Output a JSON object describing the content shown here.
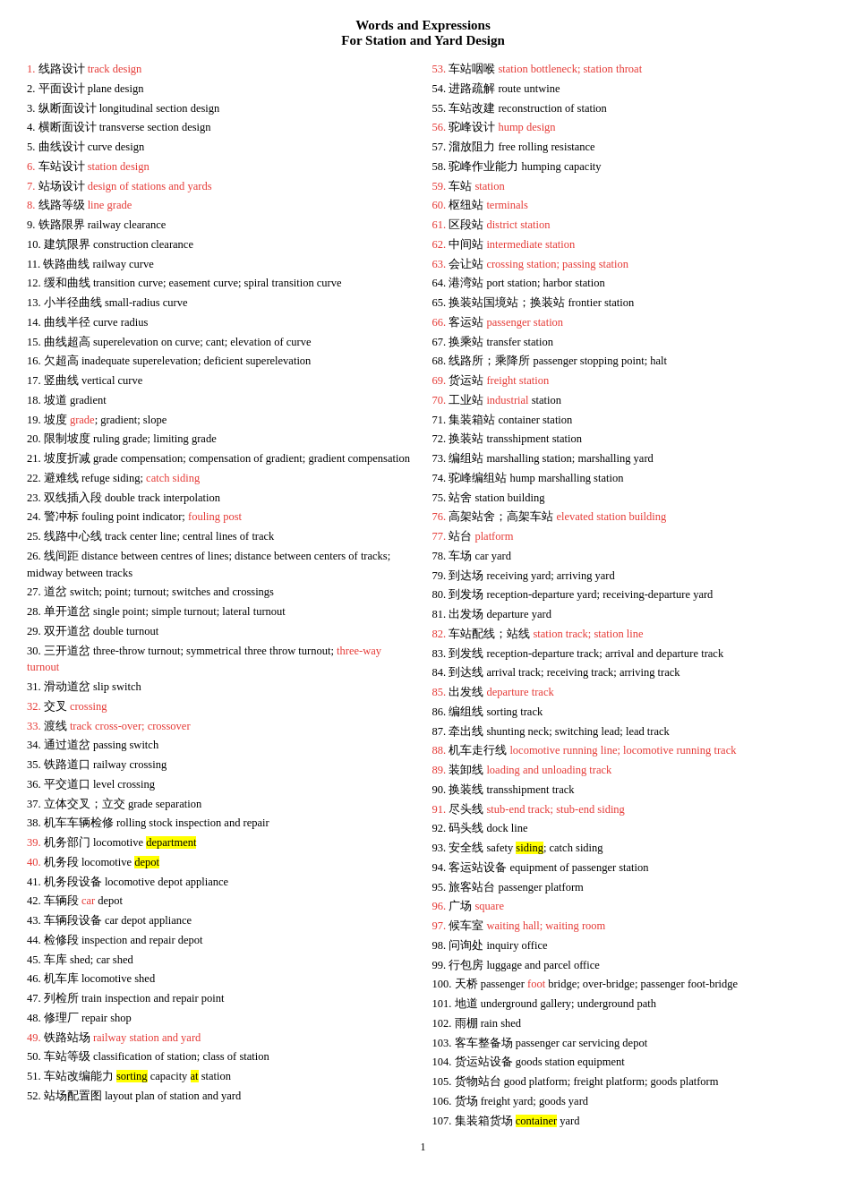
{
  "header": {
    "line1": "Words and Expressions",
    "line2": "For Station and Yard Design"
  },
  "left_items": [
    {
      "num": "1.",
      "num_color": "red",
      "content": "<span class='zh'>线路设计</span> <span class='en-red'>track design</span>"
    },
    {
      "num": "2.",
      "content": "<span class='zh'>平面设计</span> <span class='en'>plane design</span>"
    },
    {
      "num": "3.",
      "content": "<span class='zh'>纵断面设计</span> <span class='en'>longitudinal section design</span>"
    },
    {
      "num": "4.",
      "content": "<span class='zh'>横断面设计</span> <span class='en'>transverse section design</span>"
    },
    {
      "num": "5.",
      "content": "<span class='zh'>曲线设计</span> <span class='en'>curve design</span>"
    },
    {
      "num": "6.",
      "num_color": "red",
      "content": "<span class='zh'>车站设计</span> <span class='en-red'>station design</span>"
    },
    {
      "num": "7.",
      "num_color": "red",
      "content": "<span class='zh'>站场设计</span> <span class='en-red'>design of stations and yards</span>"
    },
    {
      "num": "8.",
      "num_color": "red",
      "content": "<span class='zh'>线路等级</span> <span class='en-red'>line grade</span>"
    },
    {
      "num": "9.",
      "content": "<span class='zh'>铁路限界</span> <span class='en'>railway clearance</span>"
    },
    {
      "num": "10.",
      "content": "<span class='zh'>建筑限界</span> <span class='en'>construction clearance</span>"
    },
    {
      "num": "11.",
      "content": "<span class='zh'>铁路曲线</span> <span class='en'>railway curve</span>"
    },
    {
      "num": "12.",
      "content": "<span class='zh'>缓和曲线</span> <span class='en'>transition curve; easement curve; spiral transition curve</span>"
    },
    {
      "num": "13.",
      "content": "<span class='zh'>小半径曲线</span> <span class='en'>small-radius curve</span>"
    },
    {
      "num": "14.",
      "content": "<span class='zh'>曲线半径</span> <span class='en'>curve radius</span>"
    },
    {
      "num": "15.",
      "content": "<span class='zh'>曲线超高</span> <span class='en'>superelevation on curve; cant; elevation of curve</span>"
    },
    {
      "num": "16.",
      "content": "<span class='zh'>欠超高</span> <span class='en'>inadequate superelevation; deficient superelevation</span>"
    },
    {
      "num": "17.",
      "content": "<span class='zh'>竖曲线</span> <span class='en'>vertical curve</span>"
    },
    {
      "num": "18.",
      "content": "<span class='zh'>坡道</span> <span class='en'>gradient</span>"
    },
    {
      "num": "19.",
      "content": "<span class='zh'>坡度</span> <span class='en-red'>grade</span><span class='en'>; gradient; slope</span>"
    },
    {
      "num": "20.",
      "content": "<span class='zh'>限制坡度</span> <span class='en'>ruling grade; limiting grade</span>"
    },
    {
      "num": "21.",
      "content": "<span class='zh'>坡度折减</span> <span class='en'>grade compensation; compensation of gradient; gradient compensation</span>"
    },
    {
      "num": "22.",
      "content": "<span class='zh'>避难线</span> <span class='en'>refuge siding; </span><span class='en-red'>catch siding</span>"
    },
    {
      "num": "23.",
      "content": "<span class='zh'>双线插入段</span> <span class='en'>double track interpolation</span>"
    },
    {
      "num": "24.",
      "content": "<span class='zh'>警冲标</span> <span class='en'>fouling point indicator; </span><span class='en-red'>fouling post</span>"
    },
    {
      "num": "25.",
      "content": "<span class='zh'>线路中心线</span> <span class='en'>track center line; central lines of track</span>"
    },
    {
      "num": "26.",
      "content": "<span class='zh'>线间距</span> <span class='en'>distance between centres of lines; distance between centers of tracks; midway between tracks</span>"
    },
    {
      "num": "27.",
      "content": "<span class='zh'>道岔</span> <span class='en'>switch; point; turnout; switches and crossings</span>"
    },
    {
      "num": "28.",
      "content": "<span class='zh'>单开道岔</span> <span class='en'>single point; simple turnout; lateral turnout</span>"
    },
    {
      "num": "29.",
      "content": "<span class='zh'>双开道岔</span> <span class='en'>double turnout</span>"
    },
    {
      "num": "30.",
      "content": "<span class='zh'>三开道岔</span> <span class='en'>three-throw turnout; symmetrical three throw turnout; </span><span class='en-red'>three-way turnout</span>"
    },
    {
      "num": "31.",
      "content": "<span class='zh'>滑动道岔</span> <span class='en'>slip switch</span>"
    },
    {
      "num": "32.",
      "num_color": "red",
      "content": "<span class='zh'>交叉</span> <span class='en-red'>crossing</span>"
    },
    {
      "num": "33.",
      "num_color": "red",
      "content": "<span class='zh'>渡线</span> <span class='en-red'>track cross-over; crossover</span>"
    },
    {
      "num": "34.",
      "content": "<span class='zh'>通过道岔</span> <span class='en'>passing switch</span>"
    },
    {
      "num": "35.",
      "content": "<span class='zh'>铁路道口</span> <span class='en'>railway crossing</span>"
    },
    {
      "num": "36.",
      "content": "<span class='zh'>平交道口</span> <span class='en'>level crossing</span>"
    },
    {
      "num": "37.",
      "content": "<span class='zh'>立体交叉；立交</span> <span class='en'>grade separation</span>"
    },
    {
      "num": "38.",
      "content": "<span class='zh'>机车车辆检修</span> <span class='en'>rolling stock inspection and repair</span>"
    },
    {
      "num": "39.",
      "num_color": "red",
      "content": "<span class='zh'>机务部门</span> <span class='en'>locomotive </span><span class='highlight-yellow'>department</span>"
    },
    {
      "num": "40.",
      "num_color": "red",
      "content": "<span class='zh'>机务段</span> <span class='en'>locomotive </span><span class='highlight-yellow'>depot</span>"
    },
    {
      "num": "41.",
      "content": "<span class='zh'>机务段设备</span> <span class='en'>locomotive depot appliance</span>"
    },
    {
      "num": "42.",
      "content": "<span class='zh'>车辆段</span> <span class='en-red'>car</span><span class='en'> depot</span>"
    },
    {
      "num": "43.",
      "content": "<span class='zh'>车辆段设备</span> <span class='en'>car depot appliance</span>"
    },
    {
      "num": "44.",
      "content": "<span class='zh'>检修段</span> <span class='en'>inspection and repair depot</span>"
    },
    {
      "num": "45.",
      "content": "<span class='zh'>车库</span> <span class='en'>shed; car shed</span>"
    },
    {
      "num": "46.",
      "content": "<span class='zh'>机车库</span> <span class='en'>locomotive shed</span>"
    },
    {
      "num": "47.",
      "content": "<span class='zh'>列检所</span> <span class='en'>train inspection and repair point</span>"
    },
    {
      "num": "48.",
      "content": "<span class='zh'>修理厂</span> <span class='en'>repair shop</span>"
    },
    {
      "num": "49.",
      "num_color": "red",
      "content": "<span class='zh'>铁路站场</span> <span class='en-red'>railway station and yard</span>"
    },
    {
      "num": "50.",
      "content": "<span class='zh'>车站等级</span> <span class='en'>classification of station; class of station</span>"
    },
    {
      "num": "51.",
      "content": "<span class='zh'>车站改编能力</span> <span class='en'></span><span class='highlight-yellow'>sorting</span><span class='en'> capacity </span><span class='highlight-yellow'>at</span><span class='en'> station</span>"
    },
    {
      "num": "52.",
      "content": "<span class='zh'>站场配置图</span> <span class='en'>layout plan of station and yard</span>"
    }
  ],
  "right_items": [
    {
      "num": "53.",
      "num_color": "red",
      "content": "<span class='zh'>车站咽喉</span> <span class='en-red'>station bottleneck; station throat</span>"
    },
    {
      "num": "54.",
      "content": "<span class='zh'>进路疏解</span> <span class='en'>route untwine</span>"
    },
    {
      "num": "55.",
      "content": "<span class='zh'>车站改建</span> <span class='en'>reconstruction of station</span>"
    },
    {
      "num": "56.",
      "num_color": "red",
      "content": "<span class='zh'>驼峰设计</span> <span class='en-red'>hump design</span>"
    },
    {
      "num": "57.",
      "content": "<span class='zh'>溜放阻力</span> <span class='en'>free rolling resistance</span>"
    },
    {
      "num": "58.",
      "content": "<span class='zh'>驼峰作业能力</span> <span class='en'>humping capacity</span>"
    },
    {
      "num": "59.",
      "num_color": "red",
      "content": "<span class='zh'>车站</span> <span class='en-red'>station</span>"
    },
    {
      "num": "60.",
      "num_color": "red",
      "content": "<span class='zh'>枢纽站</span> <span class='en-red'>terminals</span>"
    },
    {
      "num": "61.",
      "num_color": "red",
      "content": "<span class='zh'>区段站</span> <span class='en-red'>district station</span>"
    },
    {
      "num": "62.",
      "num_color": "red",
      "content": "<span class='zh'>中间站</span> <span class='en-red'>intermediate station</span>"
    },
    {
      "num": "63.",
      "num_color": "red",
      "content": "<span class='zh'>会让站</span> <span class='en-red'>crossing station; passing station</span>"
    },
    {
      "num": "64.",
      "content": "<span class='zh'>港湾站</span> <span class='en'>port station; harbor station</span>"
    },
    {
      "num": "65.",
      "content": "<span class='zh'>换装站国境站；换装站</span> <span class='en'>frontier station</span>"
    },
    {
      "num": "66.",
      "num_color": "red",
      "content": "<span class='zh'>客运站</span> <span class='en-red'>passenger station</span>"
    },
    {
      "num": "67.",
      "content": "<span class='zh'>换乘站</span> <span class='en'>transfer station</span>"
    },
    {
      "num": "68.",
      "content": "<span class='zh'>线路所；乘降所</span> <span class='en'>passenger stopping point; halt</span>"
    },
    {
      "num": "69.",
      "num_color": "red",
      "content": "<span class='zh'>货运站</span> <span class='en-red'>freight station</span>"
    },
    {
      "num": "70.",
      "num_color": "red",
      "content": "<span class='zh'>工业站</span> <span class='en-red'>industrial</span><span class='en'> station</span>"
    },
    {
      "num": "71.",
      "content": "<span class='zh'>集装箱站</span> <span class='en'>container station</span>"
    },
    {
      "num": "72.",
      "content": "<span class='zh'>换装站</span> <span class='en'>transshipment station</span>"
    },
    {
      "num": "73.",
      "content": "<span class='zh'>编组站</span> <span class='en'>marshalling station; marshalling yard</span>"
    },
    {
      "num": "74.",
      "content": "<span class='zh'>驼峰编组站</span> <span class='en'>hump marshalling station</span>"
    },
    {
      "num": "75.",
      "content": "<span class='zh'>站舍</span> <span class='en'>station building</span>"
    },
    {
      "num": "76.",
      "num_color": "red",
      "content": "<span class='zh'>高架站舍；高架车站</span> <span class='en-red'>elevated station building</span>"
    },
    {
      "num": "77.",
      "num_color": "red",
      "content": "<span class='zh'>站台</span> <span class='en-red'>platform</span>"
    },
    {
      "num": "78.",
      "content": "<span class='zh'>车场</span> <span class='en'>car yard</span>"
    },
    {
      "num": "79.",
      "content": "<span class='zh'>到达场</span> <span class='en'>receiving yard; arriving yard</span>"
    },
    {
      "num": "80.",
      "content": "<span class='zh'>到发场</span> <span class='en'>reception-departure yard; receiving-departure yard</span>"
    },
    {
      "num": "81.",
      "content": "<span class='zh'>出发场</span> <span class='en'>departure yard</span>"
    },
    {
      "num": "82.",
      "num_color": "red",
      "content": "<span class='zh'>车站配线；站线</span> <span class='en-red'>station track; station line</span>"
    },
    {
      "num": "83.",
      "content": "<span class='zh'>到发线</span> <span class='en'>reception-departure track; arrival and departure track</span>"
    },
    {
      "num": "84.",
      "content": "<span class='zh'>到达线</span> <span class='en'>arrival track; receiving track; arriving track</span>"
    },
    {
      "num": "85.",
      "num_color": "red",
      "content": "<span class='zh'>出发线</span> <span class='en-red'>departure track</span>"
    },
    {
      "num": "86.",
      "content": "<span class='zh'>编组线</span> <span class='en'>sorting track</span>"
    },
    {
      "num": "87.",
      "content": "<span class='zh'>牵出线</span> <span class='en'>shunting neck; switching lead; lead track</span>"
    },
    {
      "num": "88.",
      "num_color": "red",
      "content": "<span class='zh'>机车走行线</span> <span class='en-red'>locomotive running line; locomotive running track</span>"
    },
    {
      "num": "89.",
      "num_color": "red",
      "content": "<span class='zh'>装卸线</span> <span class='en-red'>loading and unloading track</span>"
    },
    {
      "num": "90.",
      "content": "<span class='zh'>换装线</span> <span class='en'>transshipment</span><span class='en'> track</span>"
    },
    {
      "num": "91.",
      "num_color": "red",
      "content": "<span class='zh'>尽头线</span> <span class='en-red'>stub-end track; stub-end siding</span>"
    },
    {
      "num": "92.",
      "content": "<span class='zh'>码头线</span> <span class='en'>dock line</span>"
    },
    {
      "num": "93.",
      "content": "<span class='zh'>安全线</span> <span class='en'>safety </span><span class='highlight-yellow'>siding</span><span class='en'>; catch siding</span>"
    },
    {
      "num": "94.",
      "content": "<span class='zh'>客运站设备</span> <span class='en'>equipment of passenger station</span>"
    },
    {
      "num": "95.",
      "content": "<span class='zh'>旅客站台</span> <span class='en'>passenger platform</span>"
    },
    {
      "num": "96.",
      "num_color": "red",
      "content": "<span class='zh'>广场</span> <span class='en-red'>square</span>"
    },
    {
      "num": "97.",
      "num_color": "red",
      "content": "<span class='zh'>候车室</span> <span class='en-red'>waiting hall; waiting room</span>"
    },
    {
      "num": "98.",
      "content": "<span class='zh'>问询处</span> <span class='en'>inquiry office</span>"
    },
    {
      "num": "99.",
      "content": "<span class='zh'>行包房</span> <span class='en'>luggage and parcel office</span>"
    },
    {
      "num": "100.",
      "content": "<span class='zh'>天桥</span> <span class='en'>passenger </span><span class='en-red'>foot</span><span class='en'> bridge; over-bridge; passenger foot-bridge</span>"
    },
    {
      "num": "101.",
      "content": "<span class='zh'>地道</span> <span class='en'>underground gallery; underground path</span>"
    },
    {
      "num": "102.",
      "content": "<span class='zh'>雨棚</span> <span class='en'>rain shed</span>"
    },
    {
      "num": "103.",
      "content": "<span class='zh'>客车整备场</span> <span class='en'>passenger car servicing depot</span>"
    },
    {
      "num": "104.",
      "content": "<span class='zh'>货运站设备</span> <span class='en'>goods station equipment</span>"
    },
    {
      "num": "105.",
      "content": "<span class='zh'>货物站台</span> <span class='en'>good platform; freight platform; goods platform</span>"
    },
    {
      "num": "106.",
      "content": "<span class='zh'>货场</span> <span class='en'>freight yard; goods yard</span>"
    },
    {
      "num": "107.",
      "content": "<span class='zh'>集装箱货场</span> <span class='en'></span><span class='highlight-yellow'>container</span><span class='en'> yard</span>"
    }
  ],
  "footer": "1"
}
